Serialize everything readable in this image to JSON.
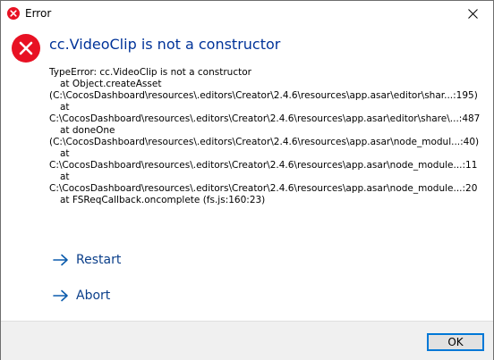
{
  "titlebar": {
    "title": "Error",
    "close_icon": "close-icon"
  },
  "dialog": {
    "main_instruction": "cc.VideoClip is not a constructor",
    "icon": "error-icon",
    "detail_lines": [
      "TypeError: cc.VideoClip is not a constructor",
      "at Object.createAsset",
      "(C:\\CocosDashboard\\resources\\.editors\\Creator\\2.4.6\\resources\\app.asar\\editor\\shar...:195)",
      "at",
      "C:\\CocosDashboard\\resources\\.editors\\Creator\\2.4.6\\resources\\app.asar\\editor\\share\\...:487",
      "at doneOne",
      "(C:\\CocosDashboard\\resources\\.editors\\Creator\\2.4.6\\resources\\app.asar\\node_modul...:40)",
      "at",
      "C:\\CocosDashboard\\resources\\.editors\\Creator\\2.4.6\\resources\\app.asar\\node_module...:11",
      "at",
      "C:\\CocosDashboard\\resources\\.editors\\Creator\\2.4.6\\resources\\app.asar\\node_module...:20",
      "at FSReqCallback.oncomplete (fs.js:160:23)"
    ],
    "commands": [
      {
        "label": "Restart",
        "icon": "arrow-right-icon"
      },
      {
        "label": "Abort",
        "icon": "arrow-right-icon"
      }
    ],
    "ok_label": "OK"
  },
  "colors": {
    "error_red": "#e81123",
    "instruction_blue": "#003399",
    "link_blue": "#0b3f8a",
    "footer_bg": "#f0f0f0",
    "button_border": "#0078d7"
  }
}
